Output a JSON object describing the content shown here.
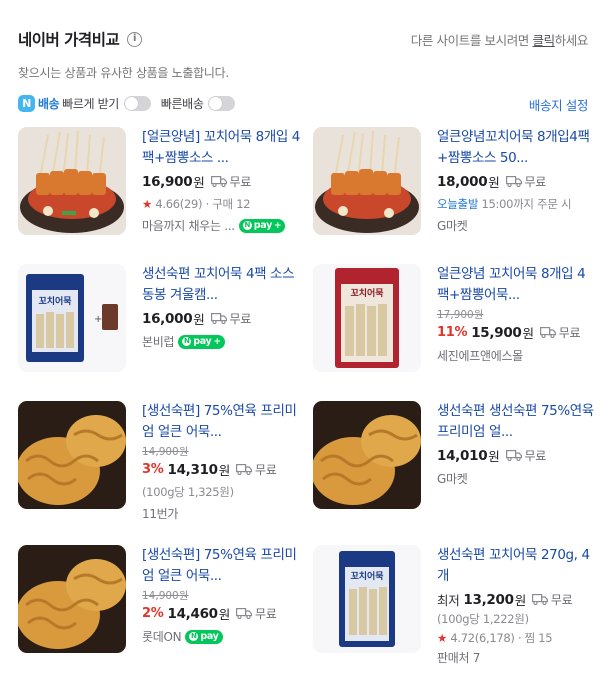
{
  "header": {
    "title": "네이버 가격비교",
    "other_site_prefix": "다른 사이트를 보시려면 ",
    "other_site_link": "클릭",
    "other_site_suffix": "하세요",
    "subtitle": "찾으시는 상품과 유사한 상품을 노출합니다."
  },
  "filters": {
    "fast_badge": "N",
    "fast_label_bold": "배송",
    "fast_label": "빠르게 받기",
    "quick_label": "빠른배송",
    "shipping_settings": "배송지 설정"
  },
  "items": [
    {
      "name": "[얼큰양념] 꼬치어묵 8개입 4팩+짬뽕소스 ...",
      "price": "16,900",
      "won": "원",
      "shipping": "무료",
      "rating": "4.66",
      "reviews": "(29)",
      "purchases": "· 구매 12",
      "seller": "마음까지 채우는 ...",
      "npay": "pay",
      "npay_plus": "+"
    },
    {
      "name": "얼큰양념꼬치어묵 8개입4팩+짬뽕소스 50...",
      "price": "18,000",
      "won": "원",
      "shipping": "무료",
      "delivery": "오늘출발",
      "delivery_note": " 15:00까지 주문 시",
      "seller": "G마켓"
    },
    {
      "name": "생선숙편 꼬치어묵 4팩 소스동봉 겨울캠...",
      "price": "16,000",
      "won": "원",
      "shipping": "무료",
      "seller": "본비럽",
      "npay": "pay",
      "npay_plus": "+"
    },
    {
      "name": "얼큰양념 꼬치어묵 8개입 4팩+짬뽕어묵...",
      "original_price": "17,900원",
      "discount": "11%",
      "price": "15,900",
      "won": "원",
      "shipping": "무료",
      "seller": "세진에프앤에스몰"
    },
    {
      "name": "[생선숙편] 75%연육 프리미엄 얼큰 어묵...",
      "original_price": "14,900원",
      "discount": "3%",
      "price": "14,310",
      "won": "원",
      "shipping": "무료",
      "unit_price": "(100g당 1,325원)",
      "seller": "11번가"
    },
    {
      "name": "생선숙편 생선숙편 75%연육 프리미엄 얼...",
      "price": "14,010",
      "won": "원",
      "shipping": "무료",
      "seller": "G마켓"
    },
    {
      "name": "[생선숙편] 75%연육 프리미엄 얼큰 어묵...",
      "original_price": "14,900원",
      "discount": "2%",
      "price": "14,460",
      "won": "원",
      "shipping": "무료",
      "seller": "롯데ON",
      "npay": "pay"
    },
    {
      "name": "생선숙편 꼬치어묵 270g, 4개",
      "price_prefix": "최저",
      "price": "13,200",
      "won": "원",
      "shipping": "무료",
      "unit_price": "(100g당 1,222원)",
      "rating": "4.72",
      "reviews": "(6,178)",
      "wish": "· 찜 15",
      "seller": "판매처 7"
    }
  ]
}
